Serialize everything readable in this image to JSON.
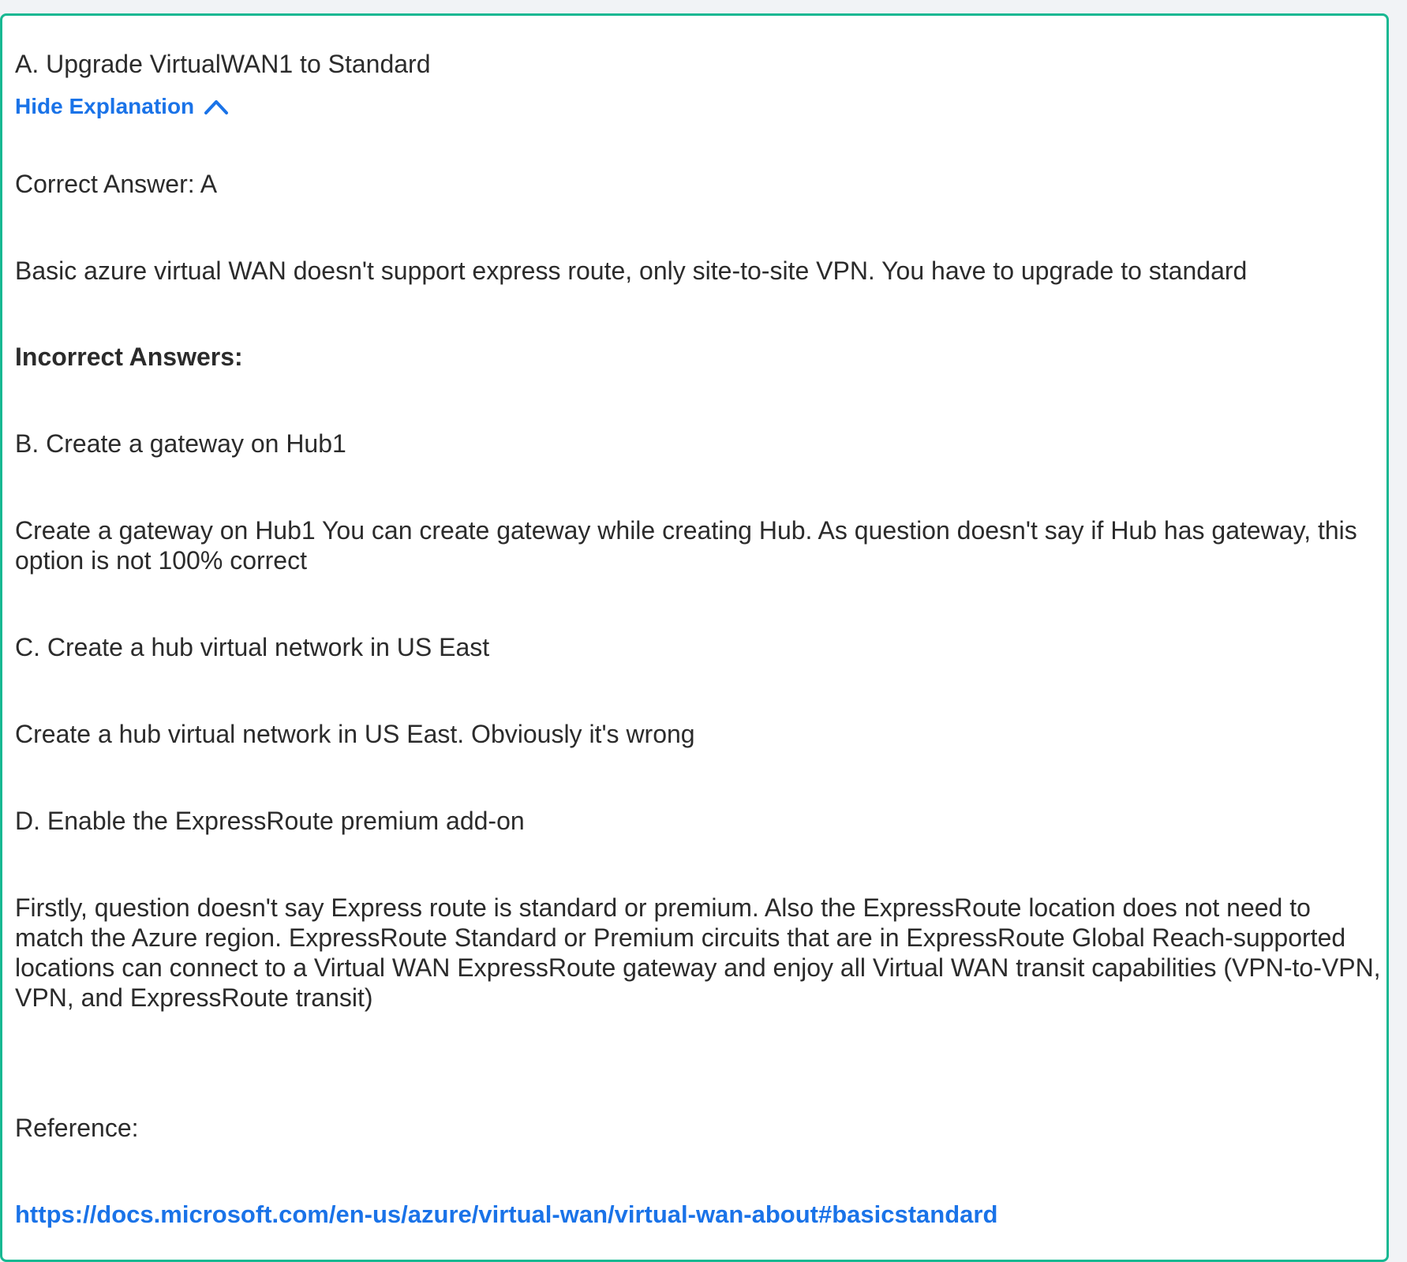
{
  "option_a": "A. Upgrade VirtualWAN1 to Standard",
  "toggle_label": "Hide Explanation",
  "correct_answer": "Correct Answer: A",
  "explanation_a": "Basic azure virtual WAN doesn't support express route, only site-to-site VPN. You have to upgrade to standard",
  "incorrect_heading": "Incorrect Answers:",
  "option_b": "B. Create a gateway on Hub1",
  "explanation_b": "Create a gateway on Hub1 You can create gateway while creating Hub. As question doesn't say if Hub has gateway, this option is not 100% correct",
  "option_c": "C. Create a hub virtual network in US East",
  "explanation_c": "Create a hub virtual network in US East. Obviously it's wrong",
  "option_d": "D. Enable the ExpressRoute premium add-on",
  "explanation_d": "Firstly, question doesn't say Express route is standard or premium. Also the ExpressRoute location does not need to match the Azure region. ExpressRoute Standard or Premium circuits that are in ExpressRoute Global Reach-supported locations can connect to a Virtual WAN ExpressRoute gateway and enjoy all Virtual WAN transit capabilities (VPN-to-VPN, VPN, and ExpressRoute transit)",
  "reference_label": "Reference:",
  "reference_url": "https://docs.microsoft.com/en-us/azure/virtual-wan/virtual-wan-about#basicstandard",
  "icons": {
    "toggle_icon": "chevron-up-icon"
  },
  "colors": {
    "accent_border": "#17b892",
    "link": "#1a73e8"
  }
}
